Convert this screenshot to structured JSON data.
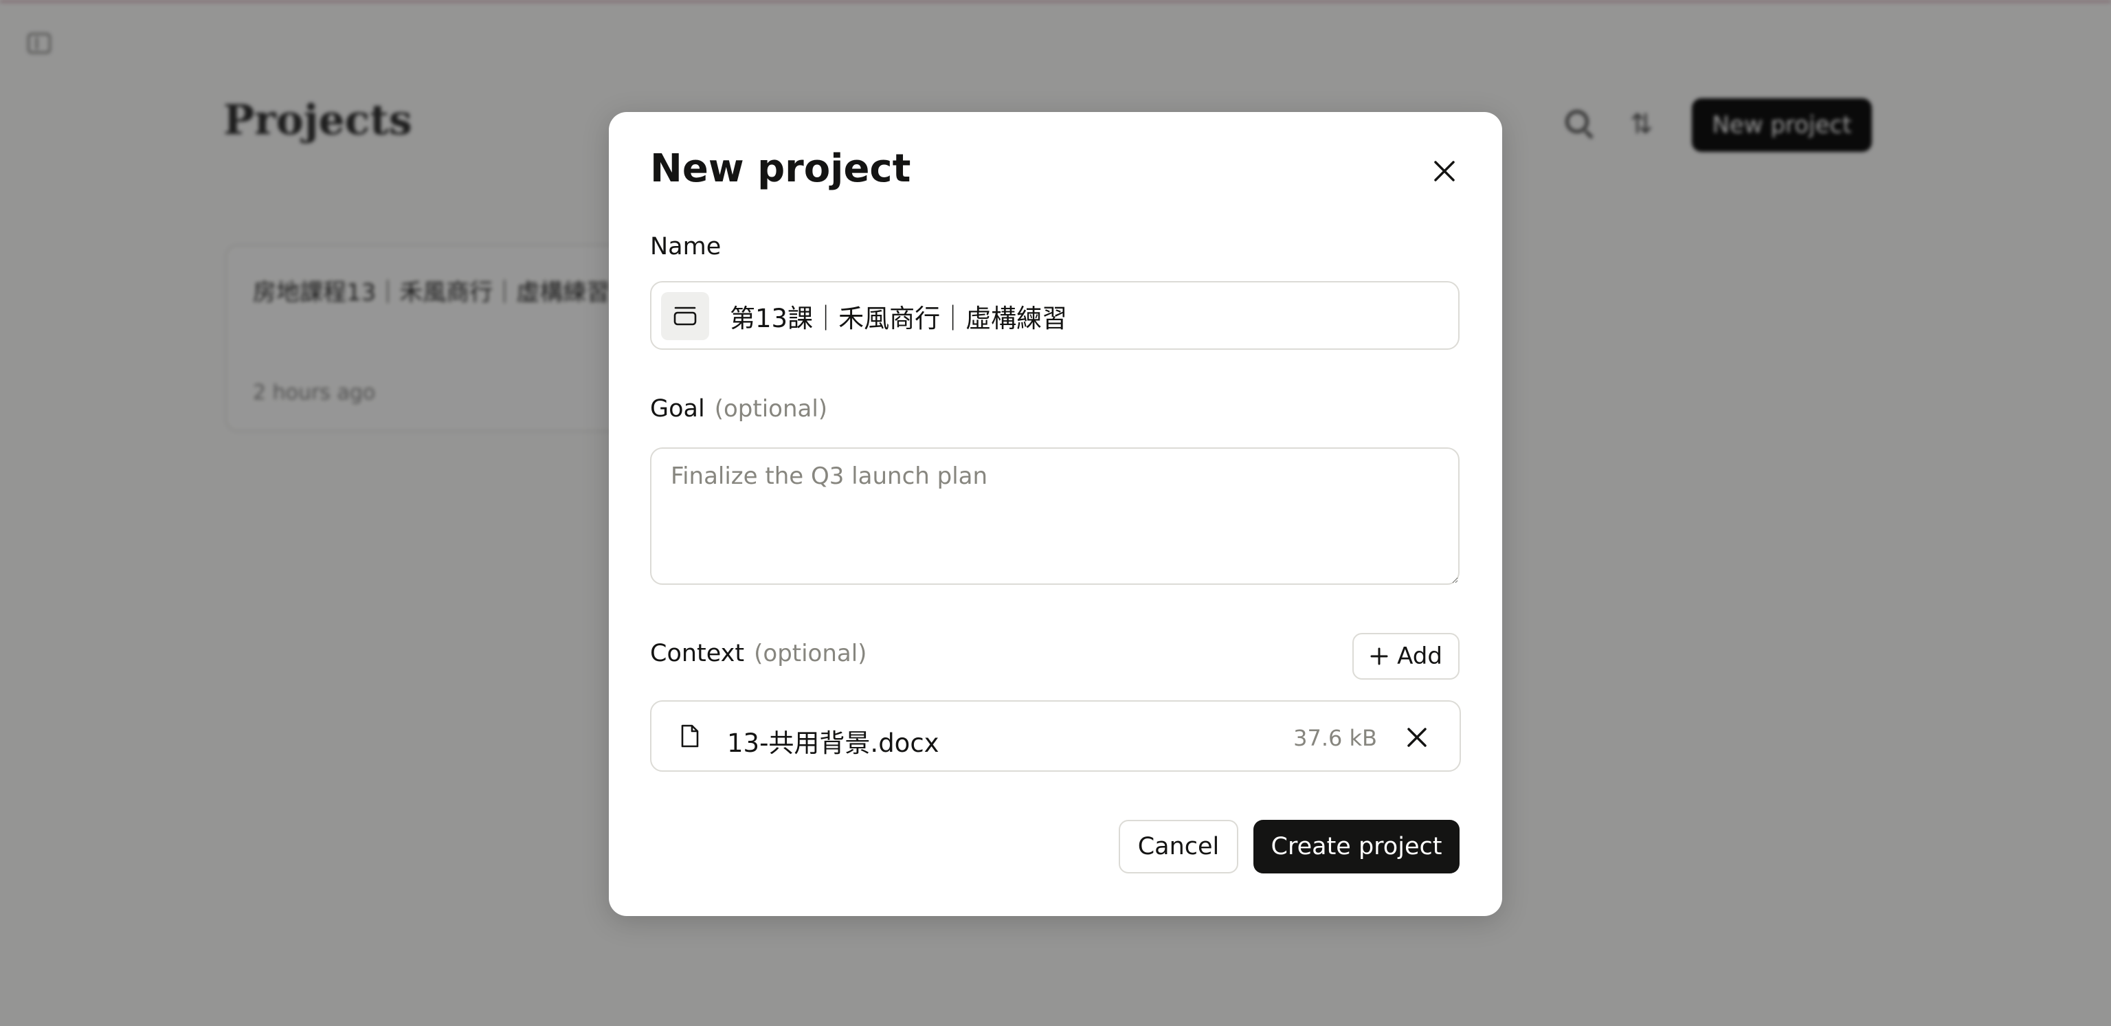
{
  "background": {
    "title": "Projects",
    "new_project_label": "New project",
    "card": {
      "title": "房地課程13｜禾風商行｜虛構練習",
      "time": "2 hours ago"
    }
  },
  "modal": {
    "title": "New project",
    "name_label": "Name",
    "name_value": "第13課｜禾風商行｜虛構練習",
    "goal_label": "Goal",
    "goal_optional": "(optional)",
    "goal_placeholder": "Finalize the Q3 launch plan",
    "context_label": "Context",
    "context_optional": "(optional)",
    "add_label": "Add",
    "file": {
      "name": "13-共用背景.docx",
      "size": "37.6 kB"
    },
    "cancel_label": "Cancel",
    "create_label": "Create project"
  },
  "colors": {
    "primary_button": "#141413",
    "muted_text": "#87867f",
    "border": "#dcdbd6"
  }
}
